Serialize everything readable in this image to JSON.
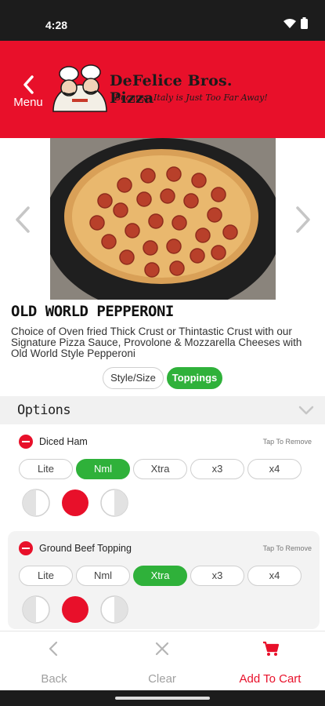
{
  "status": {
    "time": "4:28"
  },
  "header": {
    "menu_label": "Menu",
    "brand": "DeFelice Bros. Pizza",
    "tagline": "Because Italy is Just Too Far Away!"
  },
  "product": {
    "title": "OLD WORLD PEPPERONI",
    "description": "Choice of Oven fried Thick Crust or Thintastic Crust with our Signature Pizza Sauce, Provolone & Mozzarella Cheeses with Old World Style Pepperoni"
  },
  "segments": {
    "style_size": "Style/Size",
    "toppings": "Toppings"
  },
  "options": {
    "title": "Options"
  },
  "toppings": [
    {
      "name": "Diced Ham",
      "tap": "Tap To Remove",
      "selected": "Nml"
    },
    {
      "name": "Ground Beef Topping",
      "tap": "Tap To Remove",
      "selected": "Xtra"
    }
  ],
  "amount_options": [
    "Lite",
    "Nml",
    "Xtra",
    "x3",
    "x4"
  ],
  "colors": {
    "brand_red": "#e8102a",
    "accent_green": "#2fb13a"
  },
  "bottom": {
    "back": "Back",
    "clear": "Clear",
    "cart": "Add To Cart"
  }
}
